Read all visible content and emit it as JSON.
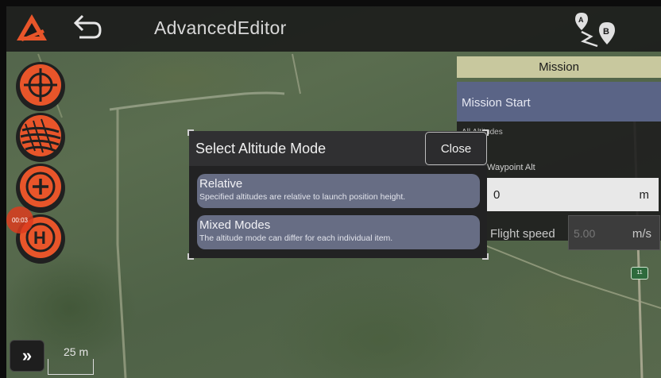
{
  "app": {
    "title": "AdvancedEditor",
    "icons": [
      "app-logo-icon",
      "back-arrow-icon",
      "route-a-b-icon"
    ]
  },
  "left_tools": [
    {
      "name": "target-icon"
    },
    {
      "name": "survey-pattern-icon"
    },
    {
      "name": "add-waypoint-icon"
    },
    {
      "name": "home-point-icon"
    }
  ],
  "recording": {
    "time": "00:03"
  },
  "mission": {
    "header": "Mission",
    "start_label": "Mission Start",
    "all_altitudes_label": "All Altitudes",
    "waypoint_alt_label": "Waypoint Alt",
    "altitude_value": "0",
    "altitude_unit": "m",
    "flight_speed_label": "Flight speed",
    "flight_speed_value": "5.00",
    "flight_speed_unit": "m/s"
  },
  "map": {
    "road_sign": "11",
    "scale_label": "25 m"
  },
  "dialog": {
    "title": "Select Altitude Mode",
    "close_label": "Close",
    "options": [
      {
        "title": "Relative",
        "description": "Specified altitudes are relative to launch position height."
      },
      {
        "title": "Mixed Modes",
        "description": "The altitude mode can differ for each individual item."
      }
    ]
  },
  "colors": {
    "accent": "#e8552a",
    "topbar": "#191919",
    "mission_header": "#c8c89e",
    "mission_start": "#5a6486",
    "option_bg": "#676d84"
  }
}
